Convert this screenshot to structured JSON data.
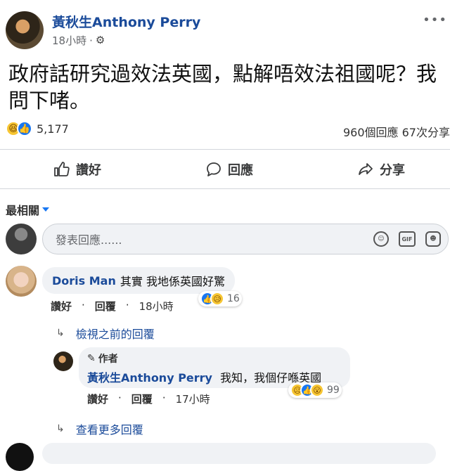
{
  "post": {
    "author": "黃秋生Anthony Perry",
    "time": "18小時",
    "text": "政府話研究過效法英國，點解唔效法祖國呢？我問下啫。",
    "reaction_count": "5,177",
    "stats": "960個回應 67次分享"
  },
  "actions": {
    "like": "讚好",
    "comment": "回應",
    "share": "分享"
  },
  "sort": {
    "label": "最相關"
  },
  "composer": {
    "placeholder": "發表回應......"
  },
  "comments": [
    {
      "name": "Doris Man",
      "text": "其實 我地係英國好驚",
      "like": "讚好",
      "reply": "回覆",
      "time": "18小時",
      "reaction_count": "16",
      "view_previous": "檢視之前的回覆",
      "replies": [
        {
          "author_tag": "作者",
          "name": "黃秋生Anthony Perry",
          "text": "我知，我個仔喺英國",
          "like": "讚好",
          "reply": "回覆",
          "time": "17小時",
          "reaction_count": "99"
        }
      ],
      "view_more": "查看更多回覆"
    }
  ],
  "colors": {
    "name_blue": "#1b4b9a",
    "like_blue": "#1877f2",
    "bubble": "#f0f2f5"
  },
  "icons": [
    "gear-icon",
    "thumbs-up-icon",
    "comment-icon",
    "share-icon",
    "emoji-icon",
    "gif-icon",
    "sticker-icon",
    "pencil-icon",
    "reply-arrow-icon"
  ]
}
